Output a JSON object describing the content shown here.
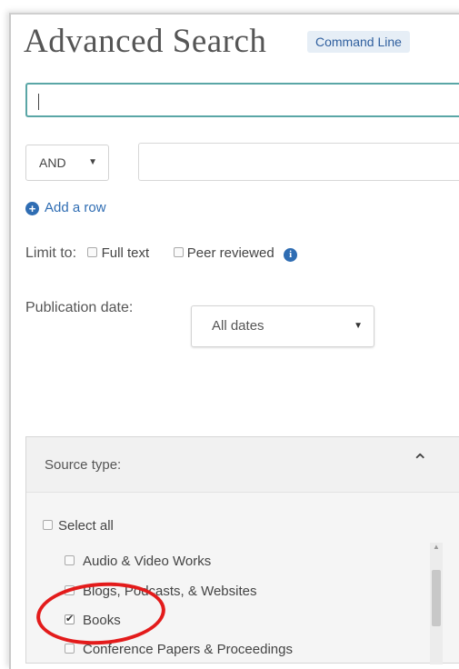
{
  "header": {
    "title": "Advanced Search",
    "command_line": "Command Line"
  },
  "search": {
    "value": "",
    "operator": "AND",
    "row2_value": "",
    "add_row": "Add a row"
  },
  "limit": {
    "label": "Limit to:",
    "full_text": "Full text",
    "peer_reviewed": "Peer reviewed",
    "full_text_checked": false,
    "peer_reviewed_checked": false
  },
  "pubdate": {
    "label": "Publication date:",
    "value": "All dates"
  },
  "source_type": {
    "title": "Source type:",
    "select_all": "Select all",
    "items": [
      {
        "label": "Audio & Video Works",
        "checked": false
      },
      {
        "label": "Blogs, Podcasts, & Websites",
        "checked": false
      },
      {
        "label": "Books",
        "checked": true
      },
      {
        "label": "Conference Papers & Proceedings",
        "checked": false
      }
    ]
  },
  "colors": {
    "accent": "#2f6db3",
    "highlight": "#e31b1b",
    "focus_border": "#5aa6a6"
  },
  "icons": {
    "add_row": "plus-circle-icon",
    "info": "info-icon",
    "collapse": "chevron-up-icon",
    "dropdown": "caret-down-icon"
  }
}
